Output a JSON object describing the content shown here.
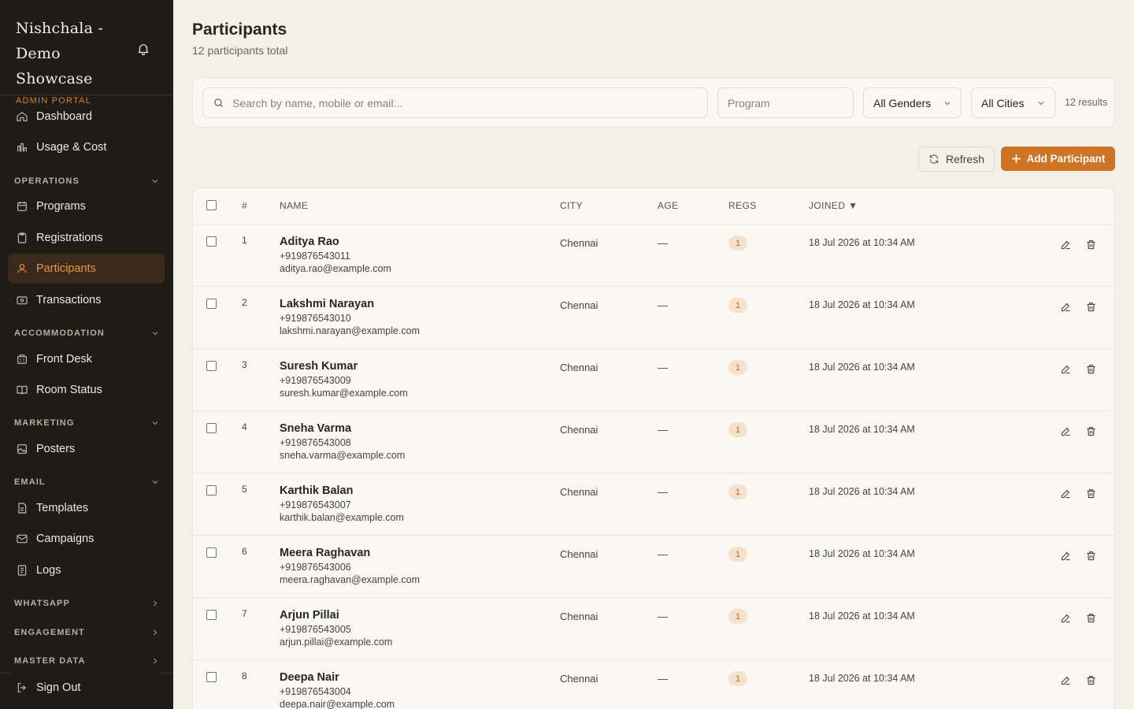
{
  "sidebar": {
    "brand_line1": "Nishchala -",
    "brand_line2": "Demo Showcase",
    "brand_sub": "ADMIN PORTAL",
    "items": [
      {
        "label": "Dashboard",
        "icon": "home-icon"
      },
      {
        "label": "Usage & Cost",
        "icon": "bar-chart-icon"
      },
      {
        "label": "Programs",
        "icon": "calendar-icon"
      },
      {
        "label": "Registrations",
        "icon": "clipboard-icon"
      },
      {
        "label": "Participants",
        "icon": "user-icon",
        "active": true
      },
      {
        "label": "Transactions",
        "icon": "wallet-icon"
      },
      {
        "label": "Front Desk",
        "icon": "building-icon"
      },
      {
        "label": "Room Status",
        "icon": "book-open-icon"
      },
      {
        "label": "Posters",
        "icon": "image-icon"
      },
      {
        "label": "Templates",
        "icon": "file-icon"
      },
      {
        "label": "Campaigns",
        "icon": "mail-icon"
      },
      {
        "label": "Logs",
        "icon": "list-icon"
      }
    ],
    "sections": [
      {
        "label": "OPERATIONS",
        "state": "expanded"
      },
      {
        "label": "ACCOMMODATION",
        "state": "expanded"
      },
      {
        "label": "MARKETING",
        "state": "expanded"
      },
      {
        "label": "EMAIL",
        "state": "expanded"
      },
      {
        "label": "WHATSAPP",
        "state": "collapsed"
      },
      {
        "label": "ENGAGEMENT",
        "state": "collapsed"
      },
      {
        "label": "MASTER DATA",
        "state": "collapsed"
      }
    ],
    "signout": "Sign Out"
  },
  "header": {
    "title": "Participants",
    "subtitle": "12 participants total"
  },
  "filters": {
    "search_placeholder": "Search by name, mobile or email...",
    "program_placeholder": "Program",
    "gender": "All Genders",
    "city": "All Cities",
    "results": "12 results"
  },
  "actions": {
    "refresh": "Refresh",
    "add": "Add Participant"
  },
  "table": {
    "headers": {
      "num": "#",
      "name": "NAME",
      "city": "CITY",
      "age": "AGE",
      "regs": "REGS",
      "joined": "JOINED ▼"
    },
    "rows": [
      {
        "num": "1",
        "name": "Aditya Rao",
        "mobile": "+919876543011",
        "email": "aditya.rao@example.com",
        "city": "Chennai",
        "age": "—",
        "regs": "1",
        "joined": "18 Jul 2026 at 10:34 AM"
      },
      {
        "num": "2",
        "name": "Lakshmi Narayan",
        "mobile": "+919876543010",
        "email": "lakshmi.narayan@example.com",
        "city": "Chennai",
        "age": "—",
        "regs": "1",
        "joined": "18 Jul 2026 at 10:34 AM"
      },
      {
        "num": "3",
        "name": "Suresh Kumar",
        "mobile": "+919876543009",
        "email": "suresh.kumar@example.com",
        "city": "Chennai",
        "age": "—",
        "regs": "1",
        "joined": "18 Jul 2026 at 10:34 AM"
      },
      {
        "num": "4",
        "name": "Sneha Varma",
        "mobile": "+919876543008",
        "email": "sneha.varma@example.com",
        "city": "Chennai",
        "age": "—",
        "regs": "1",
        "joined": "18 Jul 2026 at 10:34 AM"
      },
      {
        "num": "5",
        "name": "Karthik Balan",
        "mobile": "+919876543007",
        "email": "karthik.balan@example.com",
        "city": "Chennai",
        "age": "—",
        "regs": "1",
        "joined": "18 Jul 2026 at 10:34 AM"
      },
      {
        "num": "6",
        "name": "Meera Raghavan",
        "mobile": "+919876543006",
        "email": "meera.raghavan@example.com",
        "city": "Chennai",
        "age": "—",
        "regs": "1",
        "joined": "18 Jul 2026 at 10:34 AM"
      },
      {
        "num": "7",
        "name": "Arjun Pillai",
        "mobile": "+919876543005",
        "email": "arjun.pillai@example.com",
        "city": "Chennai",
        "age": "—",
        "regs": "1",
        "joined": "18 Jul 2026 at 10:34 AM"
      },
      {
        "num": "8",
        "name": "Deepa Nair",
        "mobile": "+919876543004",
        "email": "deepa.nair@example.com",
        "city": "Chennai",
        "age": "—",
        "regs": "1",
        "joined": "18 Jul 2026 at 10:34 AM"
      }
    ]
  },
  "colors": {
    "sidebar_bg": "#1f1b17",
    "accent": "#cf7424",
    "active_text": "#e8953f",
    "page_bg": "#f4f0e8"
  }
}
